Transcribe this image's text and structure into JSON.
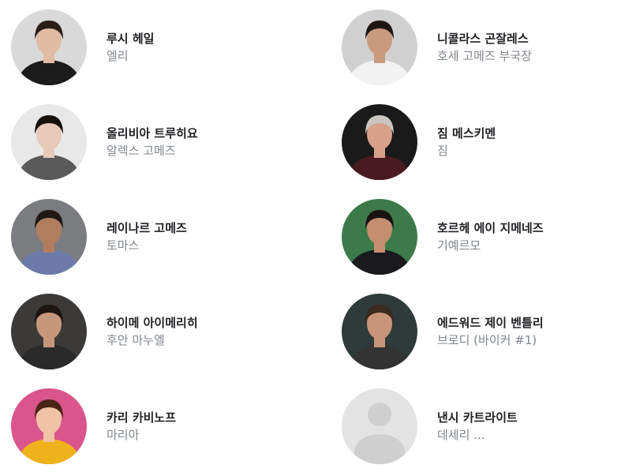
{
  "cast": [
    {
      "name": "루시 헤일",
      "role": "엘리",
      "avatar": "photo-woman-dark-hair",
      "colors": {
        "bg": "#d9d9d9",
        "skin": "#e2bba5",
        "hair": "#2a1d17",
        "cloth": "#1b1b1b"
      }
    },
    {
      "name": "니콜라스 곤잘레스",
      "role": "호세 고메즈 부국장",
      "avatar": "photo-man-bowtie",
      "colors": {
        "bg": "#d0d0d0",
        "skin": "#c99b7d",
        "hair": "#1f1612",
        "cloth": "#f2f2f2"
      }
    },
    {
      "name": "올리비아 트루히요",
      "role": "알렉스 고메즈",
      "avatar": "photo-woman-patterned-top",
      "colors": {
        "bg": "#e8e8e8",
        "skin": "#e7c9b8",
        "hair": "#14100e",
        "cloth": "#5a5a5a"
      }
    },
    {
      "name": "짐 메스키멘",
      "role": "짐",
      "avatar": "photo-man-smiling",
      "colors": {
        "bg": "#1a1a1a",
        "skin": "#d9a089",
        "hair": "#c9c6c2",
        "cloth": "#4a1a22"
      }
    },
    {
      "name": "레이나르 고메즈",
      "role": "토마스",
      "avatar": "photo-man-group",
      "colors": {
        "bg": "#7a7c80",
        "skin": "#b27d5e",
        "hair": "#1f1815",
        "cloth": "#6b7aa8"
      }
    },
    {
      "name": "호르헤 에이 지메네즈",
      "role": "기예르모",
      "avatar": "photo-man-suit",
      "colors": {
        "bg": "#3c7a4a",
        "skin": "#c58e6e",
        "hair": "#1a1411",
        "cloth": "#1a1a1e"
      }
    },
    {
      "name": "하이메 아이메리히",
      "role": "후안 마누엘",
      "avatar": "photo-man-beard",
      "colors": {
        "bg": "#3b3a38",
        "skin": "#c7977b",
        "hair": "#1c1512",
        "cloth": "#2a2a2a"
      }
    },
    {
      "name": "에드워드 제이 벤틀리",
      "role": "브로디 (바이커 #1)",
      "avatar": "photo-man-mustache",
      "colors": {
        "bg": "#2f3a3a",
        "skin": "#c99479",
        "hair": "#3a2a20",
        "cloth": "#333333"
      }
    },
    {
      "name": "카리 카비노프",
      "role": "마리아",
      "avatar": "photo-woman-curly-hair",
      "colors": {
        "bg": "#d9558b",
        "skin": "#f0c3a6",
        "hair": "#4a2416",
        "cloth": "#f0b21b"
      }
    },
    {
      "name": "낸시 카트라이트",
      "role": "데세리 ...",
      "avatar": "placeholder-person-icon",
      "colors": {
        "bg": "#e3e3e3",
        "skin": "#cfcfcf",
        "hair": "#cfcfcf",
        "cloth": "#cfcfcf"
      }
    }
  ]
}
